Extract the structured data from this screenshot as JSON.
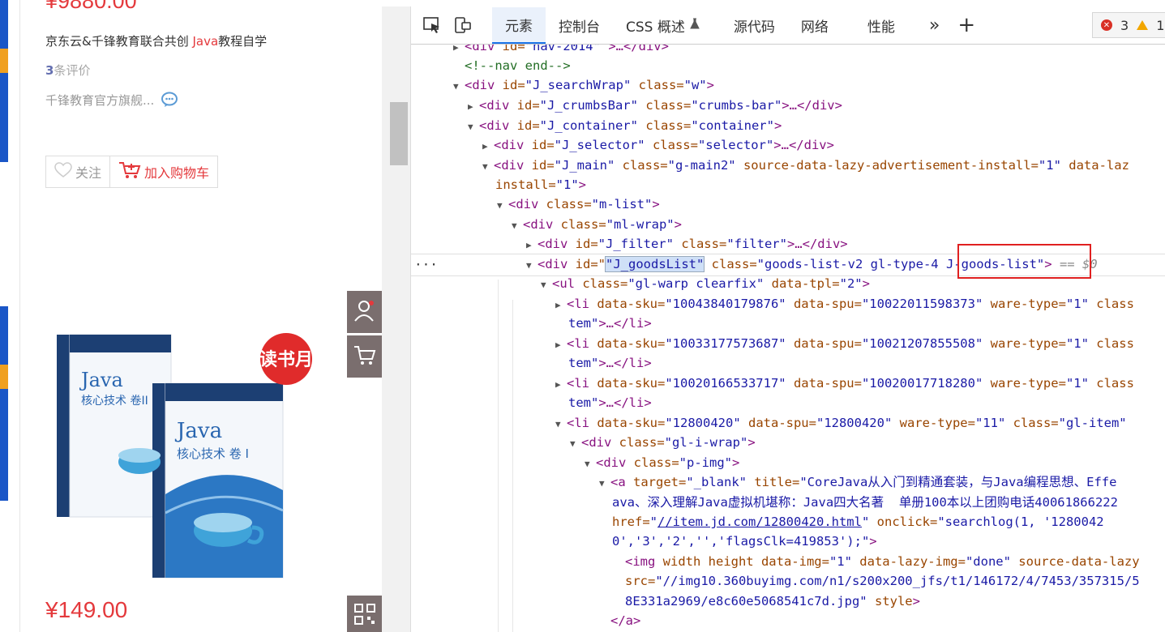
{
  "product": {
    "price_top": "¥9880.00",
    "title_prefix": "京东云&千锋教育联合共创 ",
    "title_highlight": "Java",
    "title_suffix": "教程自学",
    "comment_count": "3",
    "comment_text": "条评价",
    "shop_name": "千锋教育官方旗舰...",
    "follow_label": "关注",
    "cart_label": "加入购物车",
    "book_badge": "读书月",
    "book_title": "Java",
    "book_vol2": "核心技术 卷II",
    "book_vol1": "核心技术 卷 I",
    "price_bottom": "¥149.00"
  },
  "devtools": {
    "tabs": [
      "元素",
      "控制台",
      "CSS 概述",
      "源代码",
      "网络",
      "性能"
    ],
    "more_label": "»",
    "add_label": "+",
    "error_count": "3",
    "warning_count": "1",
    "selected_suffix": "== $0",
    "lines": {
      "l0_tag": "<div",
      "l0_attr": " id=",
      "l0_val": "\"nav-2014\"",
      "l0_rest": " >…</div>",
      "l1": "<!--nav end-->",
      "l2_attr1": " id=",
      "l2_val1": "\"J_searchWrap\"",
      "l2_attr2": " class=",
      "l2_val2": "\"w\"",
      "l3_val1": "\"J_crumbsBar\"",
      "l3_val2": "\"crumbs-bar\"",
      "l4_val1": "\"J_container\"",
      "l4_val2": "\"container\"",
      "l5_val1": "\"J_selector\"",
      "l5_val2": "\"selector\"",
      "l6_val1": "\"J_main\"",
      "l6_val2": "\"g-main2\"",
      "l6_attr3": " source-data-lazy-advertisement-install=",
      "l6_val3": "\"1\"",
      "l6_attr4": " data-laz",
      "l7_attr": "install=",
      "l7_val": "\"1\"",
      "l8_val": "\"m-list\"",
      "l9_val": "\"ml-wrap\"",
      "l10_val1": "\"J_filter\"",
      "l10_val2": "\"filter\"",
      "l11_val1": "\"J_goodsList\"",
      "l11_val2": "\"goods-list-v2 gl-type-4 J-goods-list\"",
      "l12_tag": "<ul",
      "l12_val1": "\"gl-warp clearfix\"",
      "l12_attr2": " data-tpl=",
      "l12_val2": "\"2\"",
      "l13_sku": "\"10043840179876\"",
      "l13_spu": "\"10022011598373\"",
      "l15_sku": "\"10033177573687\"",
      "l15_spu": "\"10021207855508\"",
      "l17_sku": "\"10020166533717\"",
      "l17_spu": "\"10020017718280\"",
      "li_attr1": " data-sku=",
      "li_attr2": " data-spu=",
      "li_attr3": " ware-type=",
      "li_val3": "\"1\"",
      "li_attr4": " class",
      "li_cont_val": "tem\"",
      "li_cont_rest": ">…</li>",
      "l19_sku": "\"12800420\"",
      "l19_spu": "\"12800420\"",
      "l19_wt": "\"11\"",
      "l19_class": "\"gl-item\"",
      "l20_val": "\"gl-i-wrap\"",
      "l21_val": "\"p-img\"",
      "l22_attr1": " target=",
      "l22_val1": "\"_blank\"",
      "l22_attr2": " title=",
      "l22_val2": "\"CoreJava从入门到精通套装，与Java编程思想、Effe",
      "l23": "ava、深入理解Java虚拟机堪称：Java四大名著  单册100本以上团购电话40061866222",
      "l24_attr1": "href=",
      "l24_url": "//item.jd.com/12800420.html",
      "l24_attr2": " onclick=",
      "l24_val2": "\"searchlog(1, '1280042",
      "l25_val": "0','3','2','','flagsClk=419853');\"",
      "l26_tag": "<img",
      "l26_attrs": " width height data-img=",
      "l26_val1": "\"1\"",
      "l26_attr2": " data-lazy-img=",
      "l26_val2": "\"done\"",
      "l26_attr3": " source-data-lazy",
      "l27_attr": "src=",
      "l27_val": "\"//img10.360buyimg.com/n1/s200x200_jfs/t1/146172/4/7453/357315/5",
      "l28_val": "8E331a2969/e8c60e5068541c7d.jpg\"",
      "l28_attr": " style",
      "l29": "</a>"
    }
  }
}
